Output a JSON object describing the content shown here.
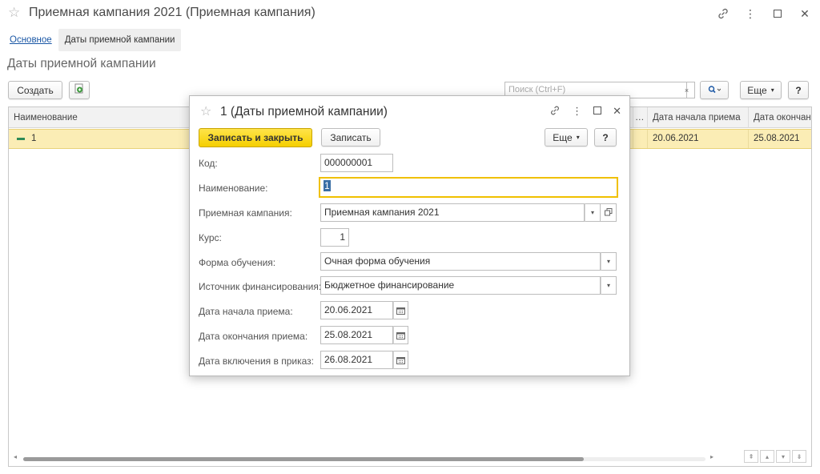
{
  "window": {
    "title": "Приемная кампания 2021 (Приемная кампания)"
  },
  "nav": {
    "link_main": "Основное",
    "active_tab": "Даты приемной кампании"
  },
  "section_title": "Даты приемной кампании",
  "toolbar": {
    "create_label": "Создать",
    "search_placeholder": "Поиск (Ctrl+F)",
    "search_clear": "×",
    "more_label": "Еще",
    "help_label": "?"
  },
  "grid": {
    "columns": [
      "Наименование",
      "…",
      "Дата начала приема",
      "Дата окончан"
    ],
    "rows": [
      {
        "name": "1",
        "start_date": "20.06.2021",
        "end_date": "25.08.2021"
      }
    ]
  },
  "dialog": {
    "title": "1 (Даты приемной кампании)",
    "save_close_label": "Записать и закрыть",
    "save_label": "Записать",
    "more_label": "Еще",
    "help_label": "?",
    "fields": {
      "code_label": "Код:",
      "code_value": "000000001",
      "name_label": "Наименование:",
      "name_value": "1",
      "campaign_label": "Приемная кампания:",
      "campaign_value": "Приемная кампания 2021",
      "course_label": "Курс:",
      "course_value": "1",
      "form_label": "Форма обучения:",
      "form_value": "Очная форма обучения",
      "funding_label": "Источник финансирования:",
      "funding_value": "Бюджетное финансирование",
      "start_label": "Дата начала приема:",
      "start_value": "20.06.2021",
      "end_label": "Дата окончания приема:",
      "end_value": "25.08.2021",
      "order_label": "Дата включения в приказ:",
      "order_value": "26.08.2021"
    }
  },
  "colors": {
    "primary_button": "#f5cf00",
    "selected_row": "#fbedb5",
    "link": "#1a57a5",
    "focus_border": "#f0c000"
  },
  "icons": [
    "star-icon",
    "link-icon",
    "more-vert-icon",
    "maximize-icon",
    "close-icon",
    "add-copy-icon",
    "search-icon",
    "chevron-down-icon",
    "calendar-icon",
    "open-form-icon"
  ]
}
